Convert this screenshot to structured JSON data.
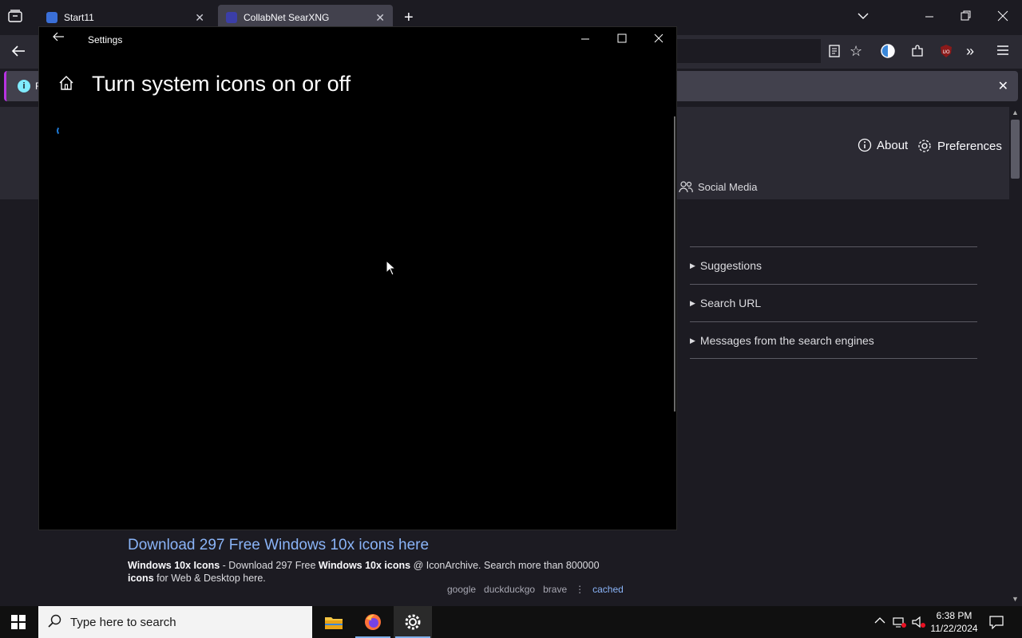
{
  "browser": {
    "tabs": [
      {
        "title": "Start11",
        "active": false
      },
      {
        "title": "CollabNet SearXNG",
        "active": true
      }
    ],
    "notification_text": "F"
  },
  "page": {
    "about_label": "About",
    "preferences_label": "Preferences",
    "social_media_label": "Social Media",
    "accordion": [
      "Suggestions",
      "Search URL",
      "Messages from the search engines"
    ],
    "result": {
      "title": "Download 297 Free Windows 10x icons here",
      "desc_b1": "Windows 10x Icons",
      "desc_t1": " - Download 297 Free ",
      "desc_b2": "Windows 10x icons",
      "desc_t2": " @ IconArchive. Search more than 800000 ",
      "desc_b3": "icons",
      "desc_t3": " for Web & Desktop here.",
      "engines": [
        "google",
        "duckduckgo",
        "brave"
      ],
      "cached_label": "cached"
    }
  },
  "settings_window": {
    "title": "Settings",
    "heading": "Turn system icons on or off"
  },
  "taskbar": {
    "search_placeholder": "Type here to search",
    "time": "6:38 PM",
    "date": "11/22/2024"
  },
  "colors": {
    "accent": "#1e7ad6",
    "link": "#8ab4f8",
    "notification_border": "#b833e1"
  }
}
